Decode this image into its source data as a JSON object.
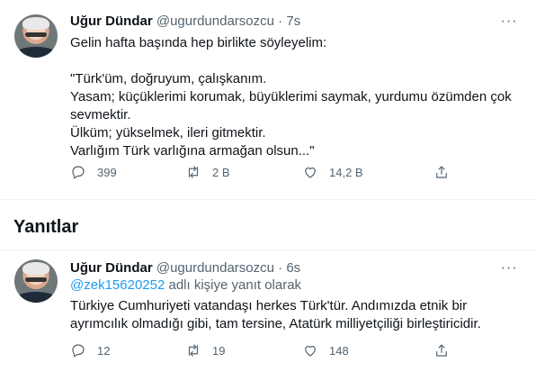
{
  "main_tweet": {
    "author_name": "Uğur Dündar",
    "handle": "@ugurdundarsozcu",
    "dot": "·",
    "time": "7s",
    "more": "···",
    "text": "Gelin hafta başında hep birlikte söyleyelim:\n\n\"Türk'üm, doğruyum, çalışkanım.\nYasam; küçüklerimi korumak, büyüklerimi saymak, yurdumu özümden çok sevmektir.\nÜlküm; yükselmek, ileri gitmektir.\nVarlığım Türk varlığına armağan olsun...\"",
    "reply_count": "399",
    "retweet_count": "2 B",
    "like_count": "14,2 B"
  },
  "replies_section": {
    "title": "Yanıtlar"
  },
  "reply_tweet": {
    "author_name": "Uğur Dündar",
    "handle": "@ugurdundarsozcu",
    "dot": "·",
    "time": "6s",
    "more": "···",
    "mention": "@zek15620252",
    "reply_suffix": " adlı kişiye yanıt olarak",
    "text": "Türkiye Cumhuriyeti vatandaşı herkes Türk'tür. Andımızda etnik bir ayrımcılık olmadığı gibi, tam tersine, Atatürk milliyetçiliği birleştiricidir.",
    "reply_count": "12",
    "retweet_count": "19",
    "like_count": "148"
  },
  "icons": {
    "reply": "reply-icon",
    "retweet": "retweet-icon",
    "like": "heart-icon",
    "share": "share-icon",
    "more": "more-icon"
  },
  "colors": {
    "text": "#0f1419",
    "secondary": "#536471",
    "link": "#1d9bf0",
    "divider": "#eff3f4"
  }
}
